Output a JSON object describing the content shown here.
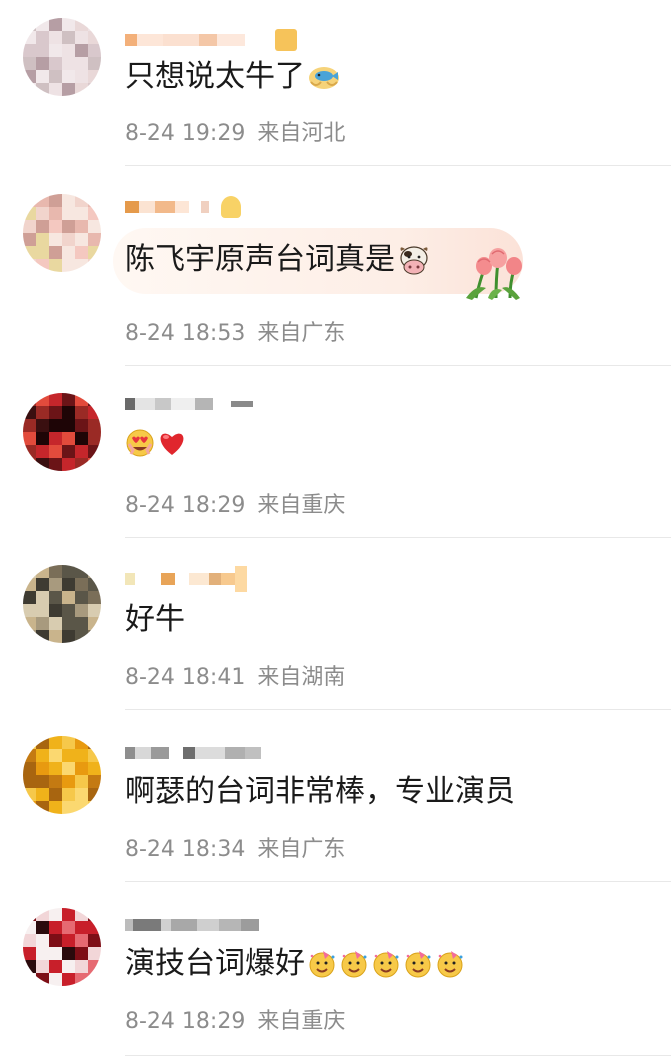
{
  "comments": [
    {
      "text": "只想说太牛了",
      "emojis": [
        "fish-hands-emoji"
      ],
      "date": "8-24 19:29",
      "location": "来自河北",
      "avatar_colors": [
        "#e9d8d8",
        "#cfc0c2",
        "#f1e8ea",
        "#b69ea4",
        "#d9c8cc",
        "#eee2e4"
      ]
    },
    {
      "text": "陈飞宇原声台词真是",
      "emojis": [
        "cow-face-emoji"
      ],
      "decoration": "tulip-bubble",
      "date": "8-24 18:53",
      "location": "来自广东",
      "avatar_colors": [
        "#e8b8ae",
        "#f1d4cc",
        "#cf9f96",
        "#f4c8c0",
        "#e9d8a0",
        "#f7e7e0"
      ]
    },
    {
      "text": "",
      "emojis": [
        "heart-eyes-emoji",
        "red-heart-emoji"
      ],
      "date": "8-24 18:29",
      "location": "来自重庆",
      "avatar_colors": [
        "#3a0f10",
        "#c5262b",
        "#6b1417",
        "#e24b3c",
        "#1e0506",
        "#9a2a25"
      ]
    },
    {
      "text": "好牛",
      "emojis": [],
      "date": "8-24 18:41",
      "location": "来自湖南",
      "avatar_colors": [
        "#7a6e58",
        "#c9b48c",
        "#3e3b32",
        "#a89a7e",
        "#d8ccb0",
        "#5a5648"
      ]
    },
    {
      "text": "啊瑟的台词非常棒，专业演员",
      "emojis": [],
      "date": "8-24 18:34",
      "location": "来自广东",
      "avatar_colors": [
        "#f0b21a",
        "#e89a10",
        "#f6c84a",
        "#c47a12",
        "#fbd870",
        "#a86510"
      ]
    },
    {
      "text": "演技台词爆好",
      "emojis": [
        "party-face-emoji",
        "party-face-emoji",
        "party-face-emoji",
        "party-face-emoji",
        "party-face-emoji"
      ],
      "date": "8-24 18:29",
      "location": "来自重庆",
      "avatar_colors": [
        "#c81f2a",
        "#7e0e16",
        "#f2d6d8",
        "#2a0a0c",
        "#e66a72",
        "#f7f0f0"
      ]
    }
  ]
}
